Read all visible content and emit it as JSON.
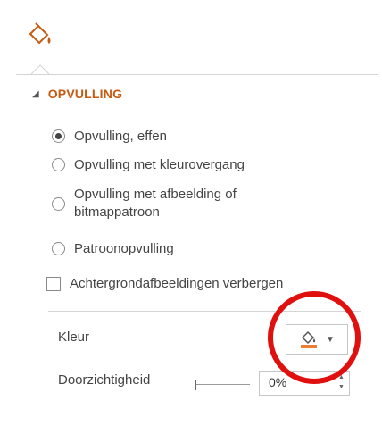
{
  "colors": {
    "accent": "#c55a11",
    "highlight_circle": "#e0100f",
    "text": "#444444"
  },
  "toolbar": {
    "fill_icon": "paint-bucket-icon"
  },
  "section": {
    "title": "OPVULLING",
    "expand_icon": "collapse-triangle-icon"
  },
  "fill_options": [
    {
      "label": "Opvulling, effen",
      "selected": true
    },
    {
      "label": "Opvulling met kleurovergang",
      "selected": false
    },
    {
      "label_line1": "Opvulling met afbeelding of",
      "label_line2": "bitmappatroon",
      "selected": false
    },
    {
      "label": "Patroonopvulling",
      "selected": false
    }
  ],
  "hide_background": {
    "label": "Achtergrondafbeeldingen verbergen",
    "checked": false
  },
  "color": {
    "label": "Kleur",
    "button_icon": "paint-bucket-icon",
    "swatch": "#ed7d31"
  },
  "transparency": {
    "label": "Doorzichtigheid",
    "value": "0%"
  }
}
